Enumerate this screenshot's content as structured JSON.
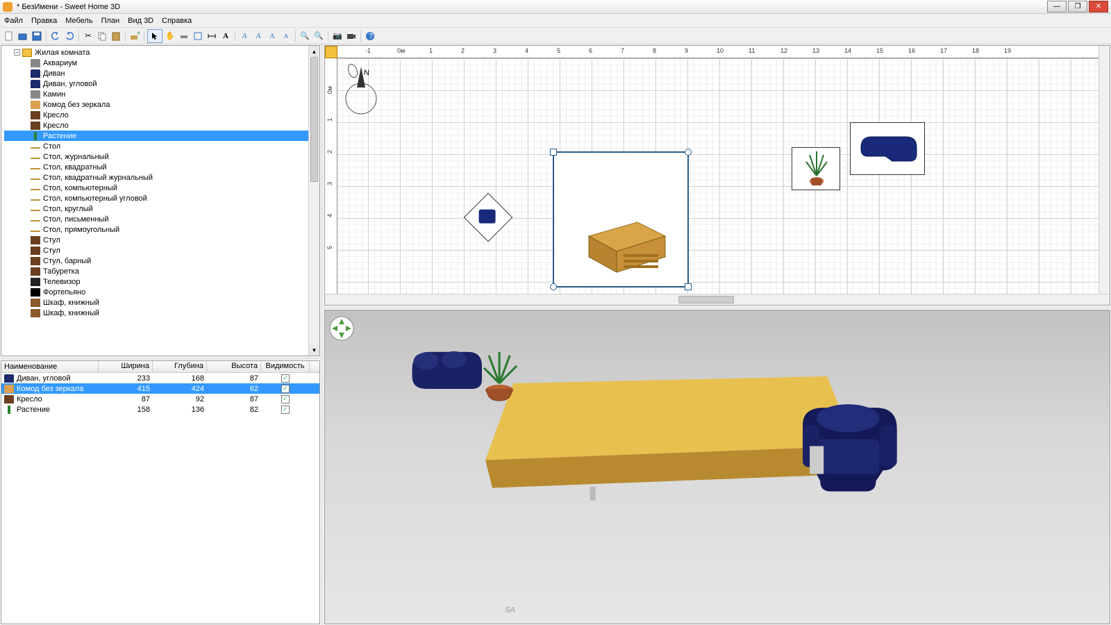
{
  "window": {
    "title": "* БезИмени - Sweet Home 3D"
  },
  "menu": {
    "file": "Файл",
    "edit": "Правка",
    "furniture": "Мебель",
    "plan": "План",
    "view3d": "Вид 3D",
    "help": "Справка"
  },
  "catalog": {
    "root": "Жилая комната",
    "items": [
      {
        "label": "Аквариум",
        "ico": "generic"
      },
      {
        "label": "Диван",
        "ico": "sofa"
      },
      {
        "label": "Диван, угловой",
        "ico": "sofa"
      },
      {
        "label": "Камин",
        "ico": "generic"
      },
      {
        "label": "Комод без зеркала",
        "ico": "dresser"
      },
      {
        "label": "Кресло",
        "ico": "chair"
      },
      {
        "label": "Кресло",
        "ico": "chair"
      },
      {
        "label": "Растение",
        "ico": "plant",
        "selected": true
      },
      {
        "label": "Стол",
        "ico": "table"
      },
      {
        "label": "Стол, журнальный",
        "ico": "table"
      },
      {
        "label": "Стол, квадратный",
        "ico": "table"
      },
      {
        "label": "Стол, квадратный журнальный",
        "ico": "table"
      },
      {
        "label": "Стол, компьютерный",
        "ico": "table"
      },
      {
        "label": "Стол, компьютерный угловой",
        "ico": "table"
      },
      {
        "label": "Стол, круглый",
        "ico": "table"
      },
      {
        "label": "Стол, письменный",
        "ico": "table"
      },
      {
        "label": "Стол, прямоугольный",
        "ico": "table"
      },
      {
        "label": "Стул",
        "ico": "chair"
      },
      {
        "label": "Стул",
        "ico": "chair"
      },
      {
        "label": "Стул, барный",
        "ico": "chair"
      },
      {
        "label": "Табуретка",
        "ico": "chair"
      },
      {
        "label": "Телевизор",
        "ico": "tv"
      },
      {
        "label": "Фортепьяно",
        "ico": "piano"
      },
      {
        "label": "Шкаф, книжный",
        "ico": "shelf"
      },
      {
        "label": "Шкаф, книжный",
        "ico": "shelf"
      }
    ]
  },
  "table": {
    "headers": {
      "name": "Наименование",
      "width": "Ширина",
      "depth": "Глубина",
      "height": "Высота",
      "visible": "Видимость"
    },
    "rows": [
      {
        "name": "Диван, угловой",
        "w": "233",
        "d": "168",
        "h": "87",
        "v": true,
        "ico": "sofa"
      },
      {
        "name": "Комод без зеркала",
        "w": "415",
        "d": "424",
        "h": "62",
        "v": true,
        "ico": "dresser",
        "selected": true
      },
      {
        "name": "Кресло",
        "w": "87",
        "d": "92",
        "h": "87",
        "v": true,
        "ico": "chair"
      },
      {
        "name": "Растение",
        "w": "158",
        "d": "136",
        "h": "82",
        "v": true,
        "ico": "plant"
      }
    ]
  },
  "ruler": {
    "h": [
      "-1",
      "0м",
      "1",
      "2",
      "3",
      "4",
      "5",
      "6",
      "7",
      "8",
      "9",
      "10",
      "11",
      "12",
      "13",
      "14",
      "15",
      "16",
      "17",
      "18",
      "19"
    ],
    "v": [
      "0м",
      "1",
      "2",
      "3",
      "4",
      "5"
    ]
  },
  "compass_label": "N"
}
